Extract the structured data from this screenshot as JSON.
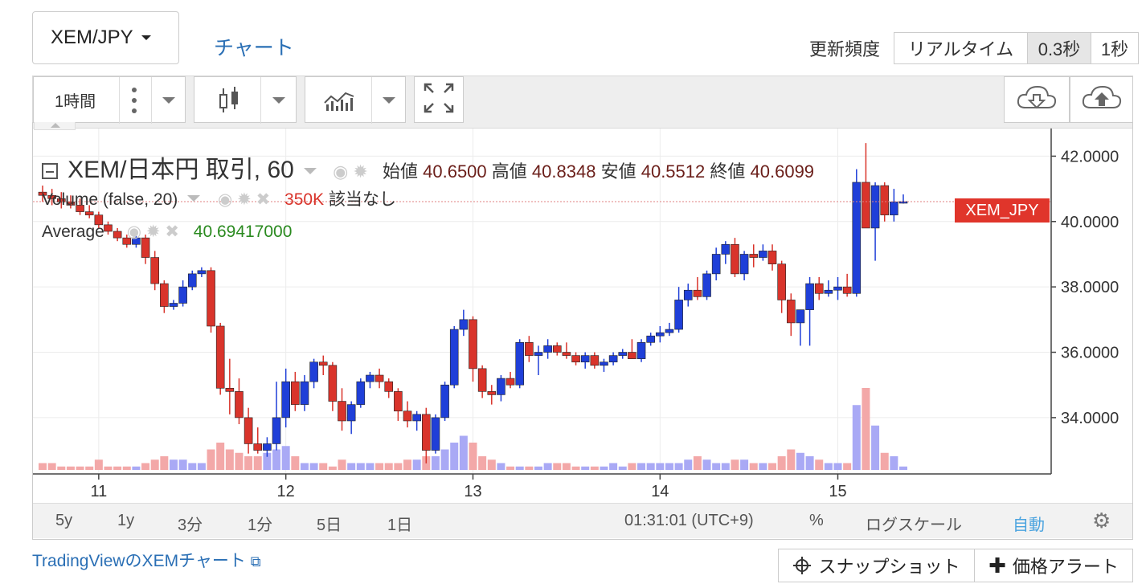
{
  "header": {
    "pair_label": "XEM/JPY",
    "chart_tab": "チャート",
    "update_label": "更新頻度",
    "update_options": [
      "リアルタイム",
      "0.3秒",
      "1秒"
    ],
    "update_active": "0.3秒"
  },
  "toolbar": {
    "interval_label": "1時間",
    "icons": [
      "more-icon",
      "candlestick-icon",
      "indicator-icon",
      "fullscreen-icon",
      "cloud-download-icon",
      "cloud-upload-icon"
    ]
  },
  "legend": {
    "main_title": "XEM/日本円 取引, 60",
    "open_label": "始値",
    "open_value": "40.6500",
    "high_label": "高値",
    "high_value": "40.8348",
    "low_label": "安値",
    "low_value": "40.5512",
    "close_label": "終値",
    "close_value": "40.6099",
    "volume_label": "Volume (false, 20)",
    "volume_value": "350K",
    "volume_na": "該当なし",
    "average_label": "Average",
    "average_value": "40.69417000"
  },
  "price_tag": "XEM_JPY",
  "colors": {
    "up": "#1f3fd8",
    "down": "#d9342b",
    "vol_up": "#a9a9f5",
    "vol_down": "#f3a8a8"
  },
  "chart_data": {
    "type": "candlestick",
    "y_ticks": [
      "42.0000",
      "40.0000",
      "38.0000",
      "36.0000",
      "34.0000"
    ],
    "ylim": [
      32.4,
      42.6
    ],
    "x_ticks": [
      "11",
      "12",
      "13",
      "14",
      "15"
    ],
    "last_price": 40.61,
    "candles": [
      [
        40.9,
        41.1,
        40.6,
        40.8
      ],
      [
        40.8,
        41.0,
        40.5,
        40.7
      ],
      [
        40.7,
        40.9,
        40.4,
        40.6
      ],
      [
        40.6,
        40.8,
        40.4,
        40.5
      ],
      [
        40.5,
        40.7,
        40.2,
        40.3
      ],
      [
        40.3,
        40.5,
        40.1,
        40.2
      ],
      [
        40.2,
        40.3,
        39.8,
        39.9
      ],
      [
        39.9,
        40.0,
        39.6,
        39.7
      ],
      [
        39.7,
        39.8,
        39.4,
        39.5
      ],
      [
        39.5,
        39.6,
        39.2,
        39.3
      ],
      [
        39.3,
        39.6,
        39.2,
        39.5
      ],
      [
        39.5,
        39.6,
        38.7,
        38.9
      ],
      [
        38.9,
        39.1,
        37.9,
        38.1
      ],
      [
        38.1,
        38.2,
        37.2,
        37.4
      ],
      [
        37.4,
        37.6,
        37.3,
        37.5
      ],
      [
        37.5,
        38.2,
        37.4,
        38.0
      ],
      [
        38.0,
        38.5,
        37.9,
        38.4
      ],
      [
        38.4,
        38.6,
        38.3,
        38.5
      ],
      [
        38.5,
        38.6,
        36.6,
        36.8
      ],
      [
        36.8,
        36.9,
        34.7,
        34.9
      ],
      [
        34.9,
        35.8,
        34.1,
        34.8
      ],
      [
        34.8,
        35.2,
        33.8,
        34.0
      ],
      [
        34.0,
        34.3,
        32.9,
        33.2
      ],
      [
        33.2,
        33.7,
        32.9,
        33.0
      ],
      [
        33.0,
        33.4,
        32.8,
        33.2
      ],
      [
        33.2,
        35.1,
        33.0,
        34.0
      ],
      [
        34.0,
        35.5,
        33.7,
        35.1
      ],
      [
        35.1,
        35.4,
        34.2,
        34.4
      ],
      [
        34.4,
        35.3,
        34.2,
        35.1
      ],
      [
        35.1,
        35.8,
        34.9,
        35.7
      ],
      [
        35.7,
        35.9,
        35.3,
        35.6
      ],
      [
        35.6,
        35.7,
        34.2,
        34.5
      ],
      [
        34.5,
        34.9,
        33.6,
        33.9
      ],
      [
        33.9,
        34.5,
        33.5,
        34.4
      ],
      [
        34.4,
        35.2,
        34.3,
        35.1
      ],
      [
        35.1,
        35.4,
        34.9,
        35.3
      ],
      [
        35.3,
        35.5,
        34.9,
        35.1
      ],
      [
        35.1,
        35.2,
        34.6,
        34.8
      ],
      [
        34.8,
        34.9,
        33.9,
        34.2
      ],
      [
        34.2,
        34.5,
        33.7,
        33.9
      ],
      [
        33.9,
        34.2,
        33.6,
        34.1
      ],
      [
        34.1,
        34.3,
        32.6,
        33.0
      ],
      [
        33.0,
        34.1,
        32.9,
        34.0
      ],
      [
        34.0,
        35.1,
        33.9,
        35.0
      ],
      [
        35.0,
        36.8,
        34.9,
        36.7
      ],
      [
        36.7,
        37.3,
        36.5,
        37.0
      ],
      [
        37.0,
        37.1,
        35.1,
        35.5
      ],
      [
        35.5,
        35.6,
        34.6,
        34.8
      ],
      [
        34.8,
        35.0,
        34.4,
        34.7
      ],
      [
        34.7,
        35.3,
        34.5,
        35.2
      ],
      [
        35.2,
        35.4,
        34.9,
        35.0
      ],
      [
        35.0,
        36.4,
        34.9,
        36.3
      ],
      [
        36.3,
        36.5,
        35.7,
        35.9
      ],
      [
        35.9,
        36.2,
        35.3,
        36.0
      ],
      [
        36.0,
        36.4,
        35.8,
        36.2
      ],
      [
        36.2,
        36.3,
        35.9,
        36.0
      ],
      [
        36.0,
        36.3,
        35.8,
        35.9
      ],
      [
        35.9,
        36.0,
        35.6,
        35.7
      ],
      [
        35.7,
        36.0,
        35.5,
        35.9
      ],
      [
        35.9,
        36.0,
        35.5,
        35.6
      ],
      [
        35.6,
        35.8,
        35.4,
        35.7
      ],
      [
        35.7,
        36.0,
        35.6,
        35.9
      ],
      [
        35.9,
        36.1,
        35.8,
        36.0
      ],
      [
        36.0,
        36.4,
        35.8,
        35.8
      ],
      [
        35.8,
        36.4,
        35.7,
        36.3
      ],
      [
        36.3,
        36.6,
        36.2,
        36.5
      ],
      [
        36.5,
        36.8,
        36.3,
        36.6
      ],
      [
        36.6,
        36.9,
        36.5,
        36.7
      ],
      [
        36.7,
        38.0,
        36.6,
        37.6
      ],
      [
        37.6,
        38.1,
        37.4,
        37.9
      ],
      [
        37.9,
        38.3,
        37.6,
        37.7
      ],
      [
        37.7,
        38.5,
        37.6,
        38.4
      ],
      [
        38.4,
        39.2,
        38.2,
        39.0
      ],
      [
        39.0,
        39.4,
        38.7,
        39.3
      ],
      [
        39.3,
        39.5,
        38.3,
        38.4
      ],
      [
        38.4,
        39.1,
        38.2,
        39.0
      ],
      [
        39.0,
        39.3,
        38.6,
        38.9
      ],
      [
        38.9,
        39.3,
        38.8,
        39.1
      ],
      [
        39.1,
        39.3,
        38.5,
        38.7
      ],
      [
        38.7,
        38.8,
        37.2,
        37.6
      ],
      [
        37.6,
        37.8,
        36.5,
        36.9
      ],
      [
        36.9,
        37.3,
        36.2,
        37.3
      ],
      [
        37.3,
        38.3,
        36.2,
        38.1
      ],
      [
        38.1,
        38.3,
        37.6,
        37.8
      ],
      [
        37.8,
        38.2,
        37.7,
        37.9
      ],
      [
        37.9,
        38.3,
        37.6,
        38.0
      ],
      [
        38.0,
        38.4,
        37.7,
        37.8
      ],
      [
        37.8,
        41.6,
        37.7,
        41.2
      ],
      [
        41.2,
        42.4,
        40.8,
        39.8
      ],
      [
        39.8,
        41.2,
        38.8,
        41.1
      ],
      [
        41.1,
        41.2,
        40.0,
        40.2
      ],
      [
        40.2,
        41.0,
        40.0,
        40.6
      ],
      [
        40.6,
        40.83,
        40.55,
        40.61
      ]
    ],
    "volumes": [
      2,
      2,
      1,
      1,
      1,
      1,
      3,
      1,
      1,
      1,
      1,
      2,
      3,
      4,
      3,
      3,
      2,
      2,
      6,
      8,
      6,
      5,
      4,
      4,
      5,
      6,
      7,
      4,
      2,
      2,
      2,
      1,
      3,
      2,
      2,
      2,
      2,
      2,
      2,
      3,
      3,
      4,
      4,
      6,
      8,
      10,
      8,
      4,
      3,
      2,
      1,
      1,
      1,
      1,
      2,
      2,
      2,
      1,
      1,
      1,
      1,
      2,
      1,
      2,
      2,
      2,
      2,
      2,
      2,
      3,
      4,
      3,
      2,
      2,
      3,
      3,
      2,
      2,
      2,
      4,
      6,
      5,
      4,
      3,
      2,
      2,
      2,
      19,
      24,
      13,
      5,
      4,
      1
    ]
  },
  "bottom": {
    "ranges": [
      "5y",
      "1y",
      "3分",
      "1分",
      "5日",
      "1日"
    ],
    "time": "01:31:01 (UTC+9)",
    "percent": "%",
    "log_scale": "ログスケール",
    "auto": "自動"
  },
  "footer": {
    "link_text": "TradingViewのXEMチャート",
    "snapshot": "スナップショット",
    "price_alert": "価格アラート"
  }
}
